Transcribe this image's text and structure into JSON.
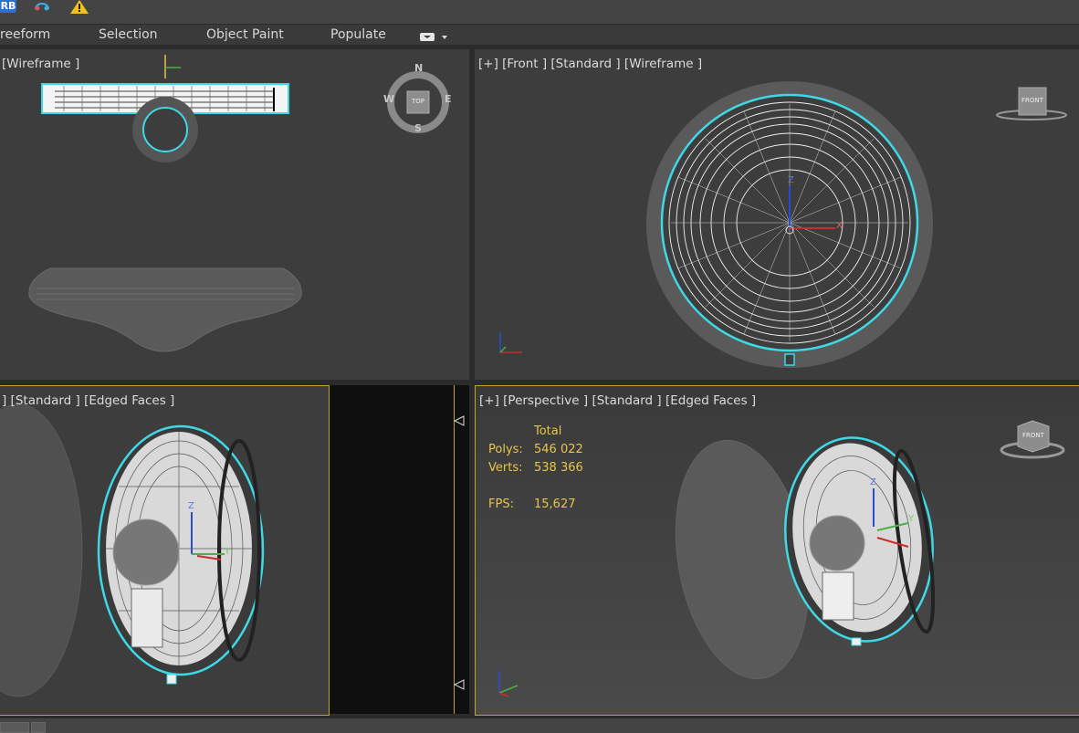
{
  "toolbar": {
    "badge_text": "RB"
  },
  "ribbon": {
    "tabs": [
      "reeform",
      "Selection",
      "Object Paint",
      "Populate"
    ]
  },
  "viewports": {
    "top": {
      "label": "[Wireframe ]",
      "compass": {
        "n": "N",
        "s": "S",
        "e": "E",
        "w": "W",
        "center": "TOP"
      }
    },
    "front": {
      "label": "[+] [Front ] [Standard ] [Wireframe ]",
      "viewcube": "FRONT",
      "axis_z": "Z",
      "axis_x": "X"
    },
    "left": {
      "label": "] [Standard ] [Edged Faces ]",
      "axis_z": "Z",
      "axis_y": "Y"
    },
    "perspective": {
      "label": "[+] [Perspective ] [Standard ] [Edged Faces ]",
      "stats": {
        "header": "Total",
        "polys_label": "Polys:",
        "polys": "546 022",
        "verts_label": "Verts:",
        "verts": "538 366",
        "fps_label": "FPS:",
        "fps": "15,627"
      },
      "viewcube": "FRONT",
      "axis_z": "Z",
      "axis_y": "Y"
    }
  },
  "colors": {
    "selection": "#3fd8e6",
    "active_border": "#c9a227",
    "stats_text": "#e8c54a",
    "grid_bg": "#3d3d3d"
  }
}
